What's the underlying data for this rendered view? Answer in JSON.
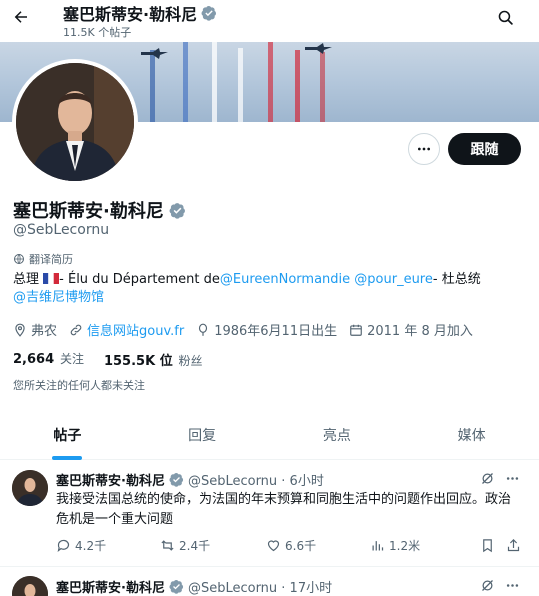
{
  "header": {
    "name": "塞巴斯蒂安·勒科尼",
    "post_count": "11.5K 个帖子"
  },
  "profile": {
    "name": "塞巴斯蒂安·勒科尼",
    "handle": "@SebLecornu",
    "follow_label": "跟随",
    "translate_label": "翻译简历",
    "bio": {
      "part1": "总理",
      "part2": "- Élu du Département de",
      "mention1": "@EureenNormandie",
      "mention2": "@pour_eure",
      "part3": "- 杜总统",
      "mention3": "@吉维尼博物馆"
    },
    "location": "弗农",
    "website": "信息网站gouv.fr",
    "birthday": "1986年6月11日出生",
    "joined": "2011 年 8 月加入",
    "following_count": "2,664",
    "following_label": "关注",
    "followers_count": "155.5K 位",
    "followers_label": "粉丝",
    "followed_note": "您所关注的任何人都未关注"
  },
  "tabs": [
    "帖子",
    "回复",
    "亮点",
    "媒体"
  ],
  "posts": [
    {
      "name": "塞巴斯蒂安·勒科尼",
      "handle_time": "@SebLecornu · 6小时",
      "text": "我接受法国总统的使命，为法国的年末预算和同胞生活中的问题作出回应。政治危机是一个重大问题",
      "replies": "4.2千",
      "reposts": "2.4千",
      "likes": "6.6千",
      "views": "1.2米"
    },
    {
      "name": "塞巴斯蒂安·勒科尼",
      "handle_time": "@SebLecornu · 17小时"
    }
  ],
  "colors": {
    "accent": "#1d9bf0",
    "verified": "#829aab",
    "text": "#0f1419",
    "muted": "#536471"
  }
}
